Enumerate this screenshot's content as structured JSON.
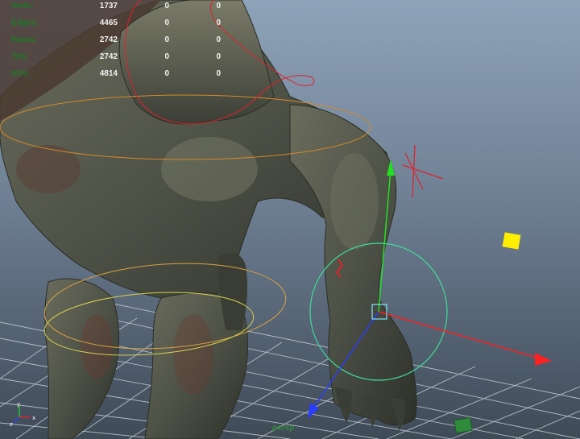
{
  "hud": {
    "rows": [
      {
        "label": "Verts:",
        "v1": "1737",
        "v2": "0",
        "v3": "0"
      },
      {
        "label": "Edges:",
        "v1": "4465",
        "v2": "0",
        "v3": "0"
      },
      {
        "label": "Faces:",
        "v1": "2742",
        "v2": "0",
        "v3": "0"
      },
      {
        "label": "Tris:",
        "v1": "2742",
        "v2": "0",
        "v3": "0"
      },
      {
        "label": "UVs:",
        "v1": "4814",
        "v2": "0",
        "v3": "0"
      }
    ]
  },
  "viewport": {
    "camera": "persp",
    "axis": {
      "x": "x",
      "y": "y",
      "z": "z"
    }
  },
  "colors": {
    "hud_label": "#1c7b27",
    "hud_value": "#f2f2f2",
    "gizmo_x": "#ff2020",
    "gizmo_y": "#22e022",
    "gizmo_z": "#2a3cff",
    "rotate_ring": "#3ddc9a",
    "ik_control": "#d8882a",
    "selection_curve": "#e0202a",
    "locator": "#ffee00"
  }
}
